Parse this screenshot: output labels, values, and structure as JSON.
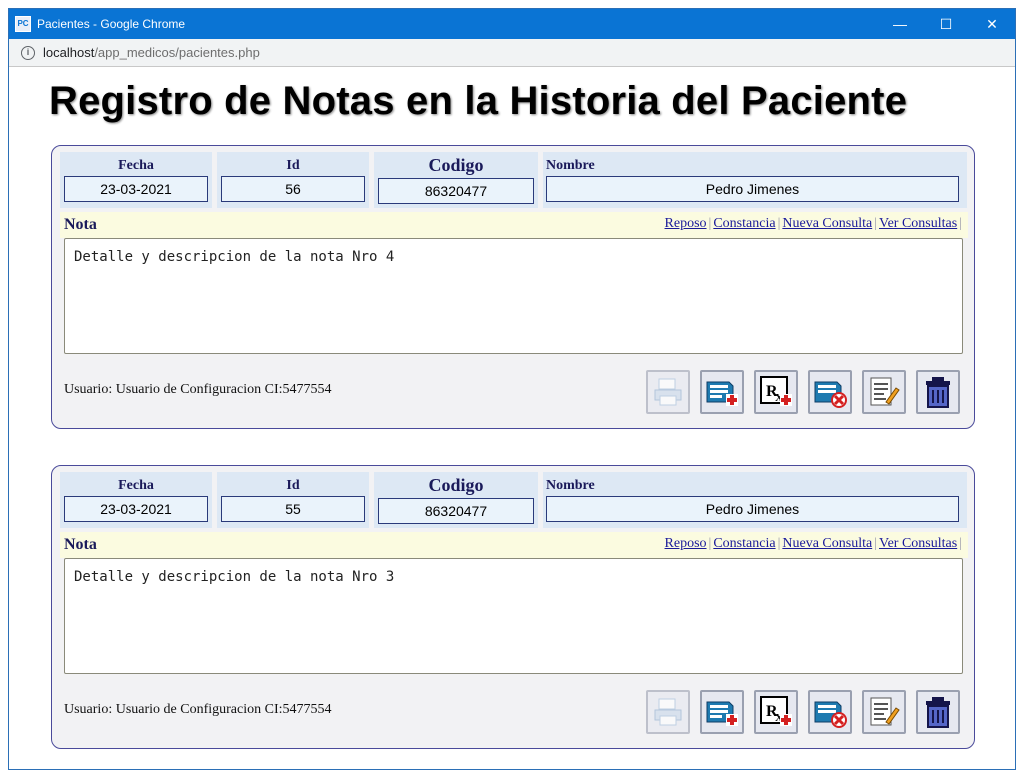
{
  "window": {
    "title": "Pacientes - Google Chrome",
    "minimize": "—",
    "maximize": "☐",
    "close": "✕"
  },
  "address": {
    "host": "localhost",
    "path": "/app_medicos/pacientes.php"
  },
  "page": {
    "title": "Registro de Notas en la Historia del Paciente"
  },
  "labels": {
    "fecha": "Fecha",
    "id": "Id",
    "codigo": "Codigo",
    "nombre": "Nombre",
    "nota": "Nota"
  },
  "links": {
    "reposo": "Reposo",
    "constancia": "Constancia",
    "nueva_consulta": "Nueva Consulta",
    "ver_consultas": "Ver Consultas",
    "sep": "|"
  },
  "notes": [
    {
      "fecha": "23-03-2021",
      "id": "56",
      "codigo": "86320477",
      "nombre": "Pedro Jimenes",
      "nota": "Detalle y descripcion de la nota Nro 4",
      "usuario": "Usuario: Usuario de Configuracion CI:5477554"
    },
    {
      "fecha": "23-03-2021",
      "id": "55",
      "codigo": "86320477",
      "nombre": "Pedro Jimenes",
      "nota": "Detalle y descripcion de la nota Nro 3",
      "usuario": "Usuario: Usuario de Configuracion CI:5477554"
    }
  ],
  "actions": [
    "print-icon",
    "add-record-icon",
    "prescription-add-icon",
    "delete-record-icon",
    "edit-note-icon",
    "trash-icon"
  ]
}
